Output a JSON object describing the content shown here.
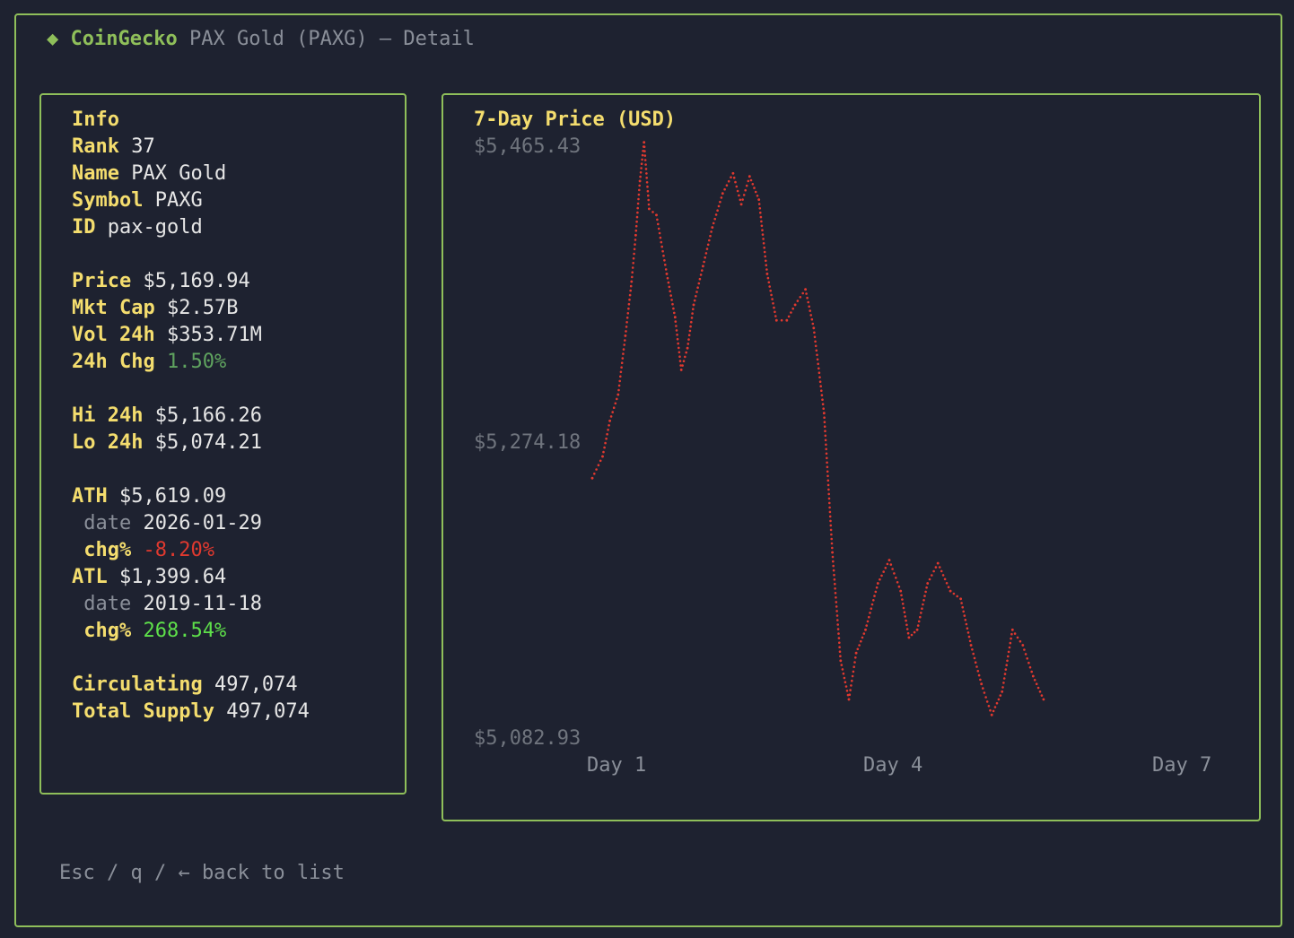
{
  "header": {
    "diamond": "◆",
    "brand": "CoinGecko",
    "subtitle": "PAX Gold (PAXG) — Detail"
  },
  "info": {
    "heading": "Info",
    "rank_label": "Rank",
    "rank": "37",
    "name_label": "Name",
    "name": "PAX Gold",
    "symbol_label": "Symbol",
    "symbol": "PAXG",
    "id_label": "ID",
    "id": "pax-gold",
    "price_label": "Price",
    "price": "$5,169.94",
    "mktcap_label": "Mkt Cap",
    "mktcap": "$2.57B",
    "vol_label": "Vol 24h",
    "vol": "$353.71M",
    "chg_label": "24h Chg",
    "chg": "1.50%",
    "hi_label": "Hi 24h",
    "hi": "$5,166.26",
    "lo_label": "Lo 24h",
    "lo": "$5,074.21",
    "ath_label": "ATH",
    "ath": "$5,619.09",
    "ath_date_label": "date",
    "ath_date": "2026-01-29",
    "ath_chg_label": "chg%",
    "ath_chg": "-8.20%",
    "atl_label": "ATL",
    "atl": "$1,399.64",
    "atl_date_label": "date",
    "atl_date": "2019-11-18",
    "atl_chg_label": "chg%",
    "atl_chg": "268.54%",
    "circ_label": "Circulating",
    "circ": "497,074",
    "supply_label": "Total Supply",
    "supply": "497,074"
  },
  "colors": {
    "accent": "#8fbf5a",
    "key": "#f4dd6e",
    "line": "#e0392f",
    "positive": "#5fa35f",
    "negative": "#e0392f"
  },
  "chart_data": {
    "type": "line",
    "title": "7-Day Price (USD)",
    "y_tick_labels": [
      "$5,465.43",
      "$5,274.18",
      "$5,082.93"
    ],
    "ylim": [
      5082.93,
      5465.43
    ],
    "x_tick_labels": [
      "Day 1",
      "Day 4",
      "Day 7"
    ],
    "xlim": [
      1,
      7
    ],
    "grid": false,
    "legend": "none",
    "series": [
      {
        "values": [
          [
            1.0,
            5248
          ],
          [
            1.1,
            5262
          ],
          [
            1.17,
            5285
          ],
          [
            1.25,
            5302
          ],
          [
            1.32,
            5340
          ],
          [
            1.38,
            5375
          ],
          [
            1.42,
            5405
          ],
          [
            1.46,
            5440
          ],
          [
            1.5,
            5465
          ],
          [
            1.55,
            5422
          ],
          [
            1.62,
            5418
          ],
          [
            1.72,
            5380
          ],
          [
            1.8,
            5352
          ],
          [
            1.86,
            5318
          ],
          [
            1.92,
            5332
          ],
          [
            1.98,
            5360
          ],
          [
            2.07,
            5385
          ],
          [
            2.16,
            5410
          ],
          [
            2.26,
            5432
          ],
          [
            2.36,
            5445
          ],
          [
            2.44,
            5425
          ],
          [
            2.52,
            5443
          ],
          [
            2.61,
            5428
          ],
          [
            2.69,
            5380
          ],
          [
            2.78,
            5350
          ],
          [
            2.88,
            5350
          ],
          [
            2.96,
            5360
          ],
          [
            3.06,
            5370
          ],
          [
            3.14,
            5345
          ],
          [
            3.24,
            5290
          ],
          [
            3.32,
            5200
          ],
          [
            3.4,
            5130
          ],
          [
            3.48,
            5105
          ],
          [
            3.55,
            5135
          ],
          [
            3.64,
            5150
          ],
          [
            3.76,
            5180
          ],
          [
            3.87,
            5195
          ],
          [
            3.98,
            5175
          ],
          [
            4.06,
            5145
          ],
          [
            4.14,
            5150
          ],
          [
            4.24,
            5180
          ],
          [
            4.34,
            5193
          ],
          [
            4.46,
            5175
          ],
          [
            4.56,
            5170
          ],
          [
            4.66,
            5140
          ],
          [
            4.76,
            5115
          ],
          [
            4.86,
            5095
          ],
          [
            4.96,
            5110
          ],
          [
            5.06,
            5150
          ],
          [
            5.16,
            5140
          ],
          [
            5.26,
            5120
          ],
          [
            5.36,
            5105
          ]
        ]
      }
    ]
  },
  "footer": {
    "hint": "Esc / q / ← back to list"
  }
}
